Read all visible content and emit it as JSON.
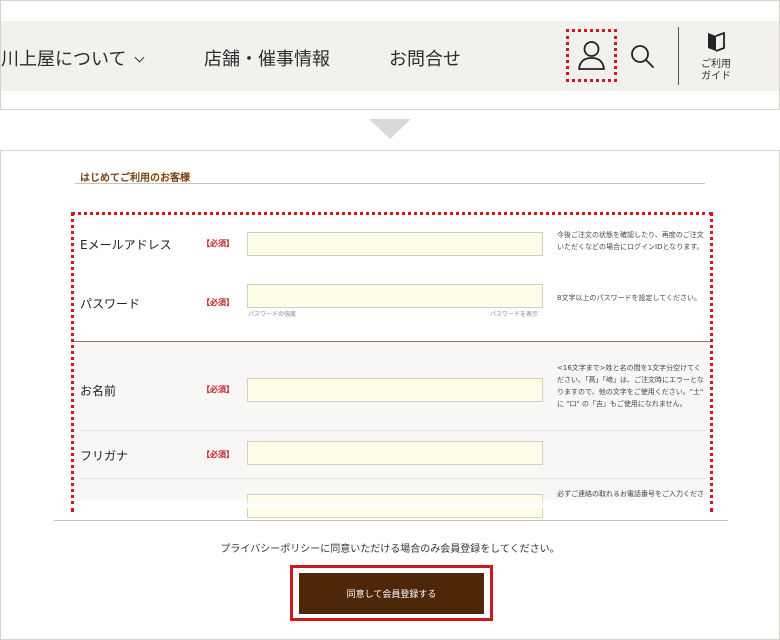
{
  "nav": {
    "about": "川上屋について",
    "stores": "店舗・催事情報",
    "contact": "お問合せ"
  },
  "guide": {
    "label": "ご利用\nガイド"
  },
  "section": {
    "title": "はじめてご利用のお客様"
  },
  "fields": {
    "email": {
      "label": "Eメールアドレス",
      "required": "【必須】",
      "note": "今後ご注文の状態を確認したり、再度のご注文いただくなどの場合にログインIDとなります。"
    },
    "password": {
      "label": "パスワード",
      "required": "【必須】",
      "strength": "パスワードの強度",
      "show": "パスワードを表示",
      "note": "8文字以上のパスワードを設定してください。"
    },
    "name": {
      "label": "お名前",
      "required": "【必須】",
      "note": "<16文字まで>姓と名の間を1文字分空けてください。「髙」「﨑」は、ご注文時にエラーとなりますので、他の文字をご使用ください。\"土\" に \"口\" の「吉」もご使用になれません。"
    },
    "kana": {
      "label": "フリガナ",
      "required": "【必須】"
    },
    "phone": {
      "note": "必ずご連絡の取れるお電話番号をご入力ください"
    }
  },
  "privacy_text": "プライバシーポリシーに同意いただける場合のみ会員登録をしてください。",
  "submit_label": "同意して会員登録する",
  "colors": {
    "accent_red": "#d0161e",
    "brand_brown": "#4e2709",
    "input_bg": "#fefde8"
  },
  "icons": [
    "user-icon",
    "search-icon",
    "book-icon",
    "chevron-down-icon"
  ]
}
